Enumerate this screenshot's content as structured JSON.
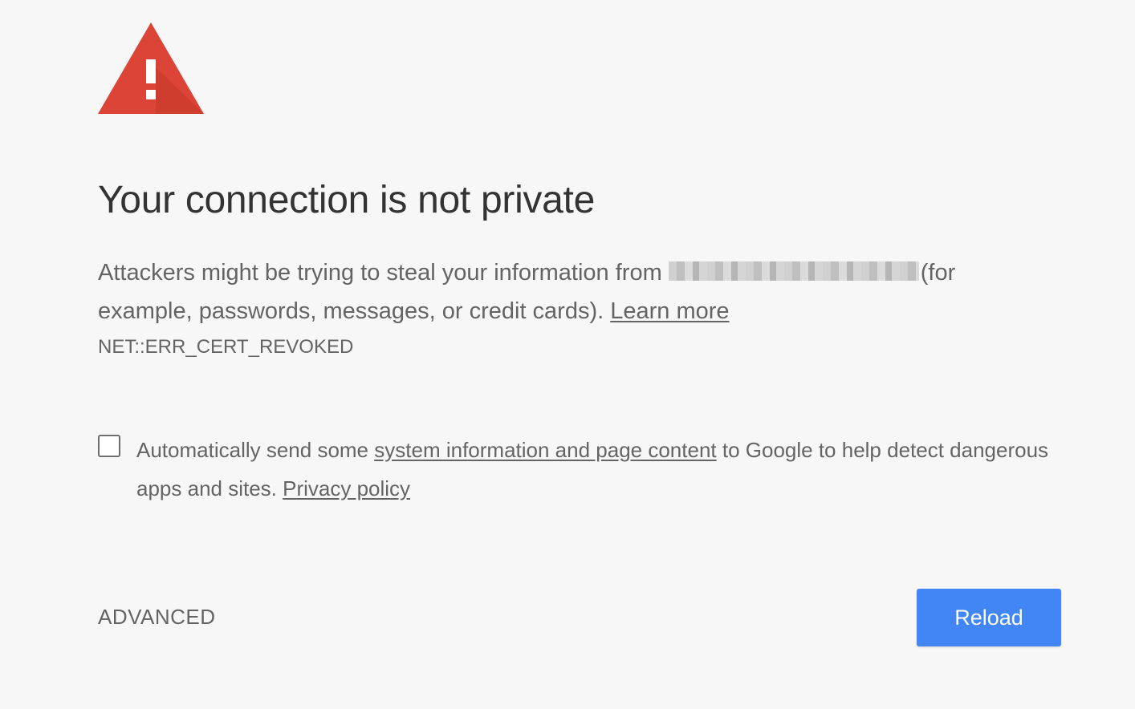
{
  "icon": "warning-triangle-icon",
  "colors": {
    "background": "#f7f7f7",
    "warning_red": "#db4437",
    "button_blue": "#4285f4",
    "title_text": "#333333",
    "body_text": "#646464"
  },
  "title": "Your connection is not private",
  "description": {
    "before_domain": "Attackers might be trying to steal your information from",
    "after_domain": "(for example, passwords, messages, or credit cards).",
    "learn_more": "Learn more"
  },
  "error_code": "NET::ERR_CERT_REVOKED",
  "opt_in": {
    "text_before": "Automatically send some",
    "link": "system information and page content",
    "text_after": "to Google to help detect dangerous apps and sites.",
    "privacy_link": "Privacy policy",
    "checked": false
  },
  "actions": {
    "advanced": "ADVANCED",
    "reload": "Reload"
  }
}
